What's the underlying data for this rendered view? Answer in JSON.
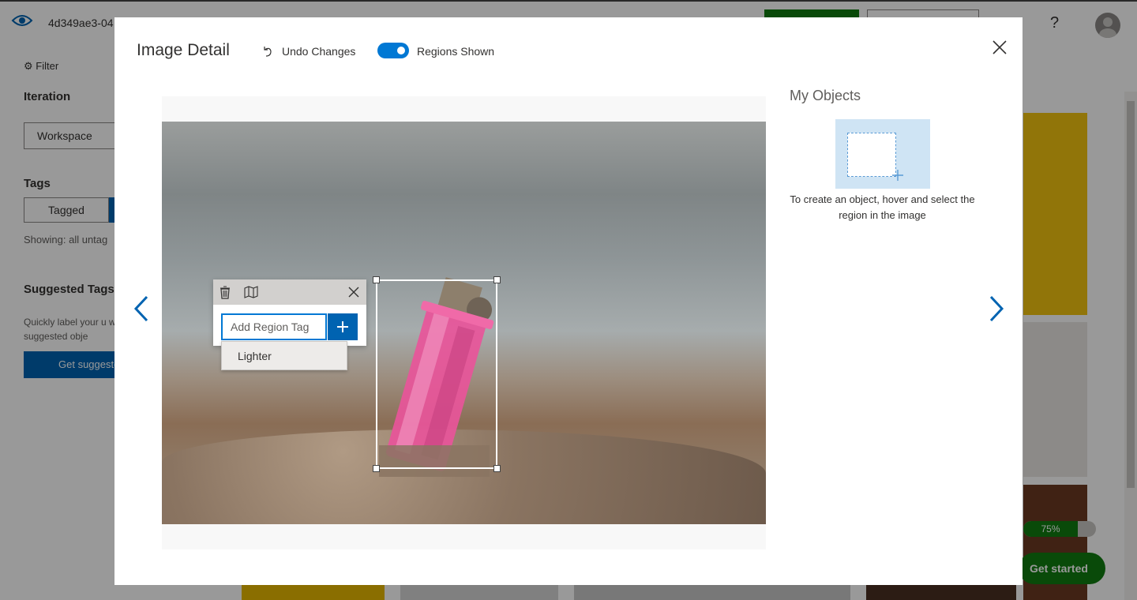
{
  "app": {
    "project_name": "4d349ae3-04",
    "filter_label": "Filter",
    "iteration_label": "Iteration",
    "iteration_value": "Workspace",
    "tags_label": "Tags",
    "tagged_label": "Tagged",
    "showing_text": "Showing: all untag",
    "suggested_title": "Suggested Tags",
    "suggested_desc": "Quickly label your u with suggested obje",
    "get_suggested_label": "Get suggeste",
    "help_label": "?",
    "onboarding_progress": "75%",
    "get_started_label": "Get started"
  },
  "modal": {
    "title": "Image Detail",
    "undo_label": "Undo Changes",
    "regions_toggle_label": "Regions Shown",
    "regions_toggle_on": true
  },
  "region_editor": {
    "input_placeholder": "Add Region Tag",
    "add_symbol": "+",
    "suggestions": [
      "Lighter"
    ]
  },
  "objects_panel": {
    "title": "My Objects",
    "hint": "To create an object, hover and select the region in the image"
  },
  "colors": {
    "accent_blue": "#0078d4",
    "button_blue": "#0063b1",
    "green": "#107c10",
    "lighter_pink": "#e8559a"
  },
  "icons": [
    "eye-icon",
    "filter-icon",
    "undo-icon",
    "close-icon",
    "chevron-left-icon",
    "chevron-right-icon",
    "delete-icon",
    "map-icon",
    "plus-icon"
  ]
}
